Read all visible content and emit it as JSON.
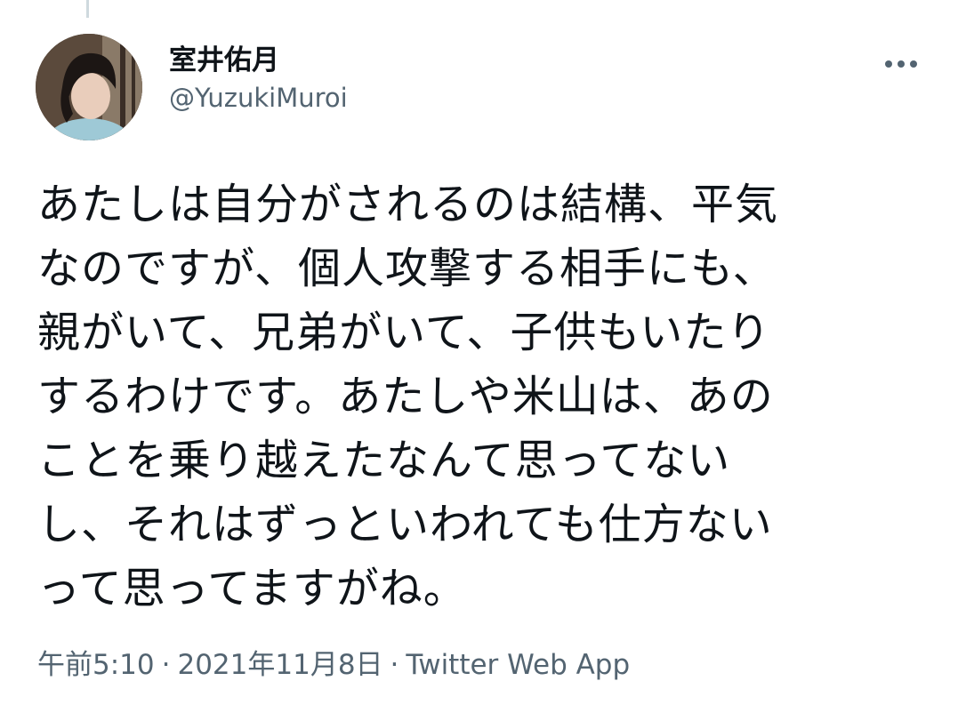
{
  "author": {
    "display_name": "室井佑月",
    "handle": "@YuzukiMuroi"
  },
  "tweet": {
    "lines": [
      "あたしは自分がされるのは結構、平気",
      "なのですが、個人攻撃する相手にも、",
      "親がいて、兄弟がいて、子供もいたり",
      "するわけです。あたしや米山は、あの",
      "ことを乗り越えたなんて思ってない",
      "し、それはずっといわれても仕方ない",
      "って思ってますがね。"
    ]
  },
  "meta": {
    "time": "午前5:10",
    "separator": "·",
    "date": "2021年11月8日",
    "source": "Twitter Web App"
  },
  "icons": {
    "more": "more-horizontal-icon"
  },
  "colors": {
    "text": "#0f1419",
    "secondary": "#536471",
    "thread_line": "#cfd9de"
  }
}
